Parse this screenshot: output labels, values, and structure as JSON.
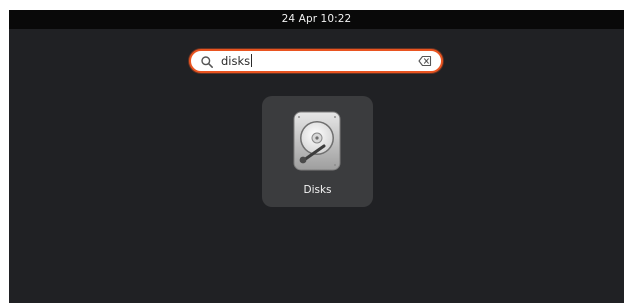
{
  "topbar": {
    "clock": "24 Apr  10:22"
  },
  "search": {
    "value": "disks",
    "search_icon": "search-icon",
    "clear_icon": "clear-input-icon"
  },
  "results": [
    {
      "label": "Disks",
      "icon": "hard-disk-icon"
    }
  ],
  "colors": {
    "accent": "#e95420",
    "overview_background": "#202124",
    "topbar_background": "#090909",
    "tile_background": "#3b3c3e"
  }
}
